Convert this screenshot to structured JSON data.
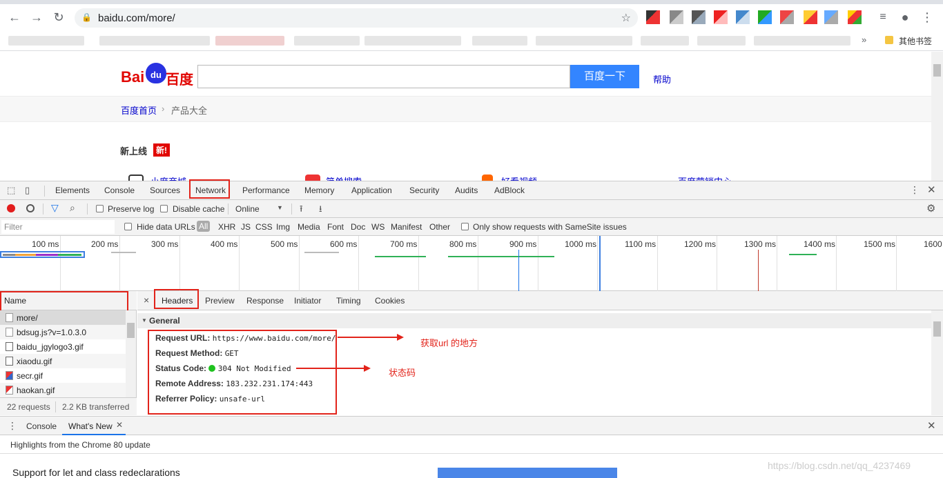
{
  "browser": {
    "url": "baidu.com/more/",
    "bookmarks_folder": "其他书签"
  },
  "page": {
    "logo_text": "Bai",
    "logo_paw_text": "du",
    "logo_cn": "百度",
    "search_button": "百度一下",
    "help_link": "帮助",
    "breadcrumb_home": "百度首页",
    "breadcrumb_sep": "›",
    "breadcrumb_current": "产品大全",
    "section_title": "新上线",
    "new_badge": "新!",
    "products": [
      "小度商城",
      "简单搜索",
      "好看视频",
      "百度营销中心"
    ]
  },
  "devtools": {
    "tabs": [
      "Elements",
      "Console",
      "Sources",
      "Network",
      "Performance",
      "Memory",
      "Application",
      "Security",
      "Audits",
      "AdBlock"
    ],
    "active_tab": "Network",
    "toolbar": {
      "preserve_log": "Preserve log",
      "disable_cache": "Disable cache",
      "throttle": "Online"
    },
    "filter": {
      "placeholder": "Filter",
      "hide_data_urls": "Hide data URLs",
      "types": [
        "All",
        "XHR",
        "JS",
        "CSS",
        "Img",
        "Media",
        "Font",
        "Doc",
        "WS",
        "Manifest",
        "Other"
      ],
      "samesite": "Only show requests with SameSite issues"
    },
    "timeline_ticks": [
      "100 ms",
      "200 ms",
      "300 ms",
      "400 ms",
      "500 ms",
      "600 ms",
      "700 ms",
      "800 ms",
      "900 ms",
      "1000 ms",
      "1100 ms",
      "1200 ms",
      "1300 ms",
      "1400 ms",
      "1500 ms",
      "1600"
    ],
    "requests": {
      "header": "Name",
      "items": [
        "more/",
        "bdsug.js?v=1.0.3.0",
        "baidu_jgylogo3.gif",
        "xiaodu.gif",
        "secr.gif",
        "haokan.gif"
      ],
      "count": "22 requests",
      "transferred": "2.2 KB transferred"
    },
    "detail": {
      "close": "×",
      "tabs": [
        "Headers",
        "Preview",
        "Response",
        "Initiator",
        "Timing",
        "Cookies"
      ],
      "section": "General",
      "headers": [
        {
          "key": "Request URL:",
          "value": "https://www.baidu.com/more/"
        },
        {
          "key": "Request Method:",
          "value": "GET"
        },
        {
          "key": "Status Code:",
          "value": "304 Not Modified"
        },
        {
          "key": "Remote Address:",
          "value": "183.232.231.174:443"
        },
        {
          "key": "Referrer Policy:",
          "value": "unsafe-url"
        }
      ]
    },
    "annotations": {
      "url_note": "获取url 的地方",
      "status_note": "状态码"
    },
    "drawer": {
      "tabs": [
        "Console",
        "What's New"
      ],
      "highlight": "Highlights from the Chrome 80 update",
      "item": "Support for let and class redeclarations",
      "watermark": "https://blog.csdn.net/qq_4237469"
    }
  }
}
